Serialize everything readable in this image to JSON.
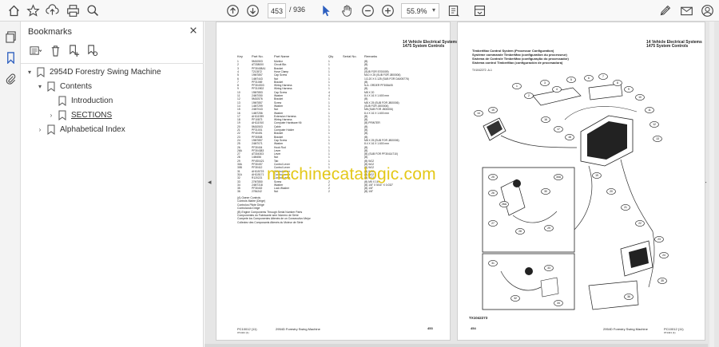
{
  "toolbar": {
    "page_current": "453",
    "page_separator": "/",
    "page_total": "936",
    "zoom": "55.9%",
    "icons": [
      "home-icon",
      "star-icon",
      "upload-icon",
      "print-icon",
      "search-icon",
      "page-up-icon",
      "page-down-icon",
      "cursor-icon",
      "hand-icon",
      "zoom-out-icon",
      "zoom-in-icon",
      "fit-page-icon",
      "view-mode-icon",
      "edit-pdf-icon",
      "mail-icon",
      "account-icon"
    ]
  },
  "sidebar": {
    "title": "Bookmarks",
    "items": [
      {
        "label": "2954D Forestry Swing Machine",
        "toggle": "▾",
        "level": 0
      },
      {
        "label": "Contents",
        "toggle": "▾",
        "level": 1
      },
      {
        "label": "Introduction",
        "toggle": "",
        "level": 2
      },
      {
        "label": "SECTIONS",
        "toggle": "›",
        "level": 2
      },
      {
        "label": "Alphabetical Index",
        "toggle": "›",
        "level": 1
      }
    ]
  },
  "document": {
    "watermark": "machinecatalogic.com",
    "left_page": {
      "header1": "14 Vehicle Electrical Systems",
      "header2": "1475 System Controls",
      "columns": [
        "Key",
        "Part No.",
        "Part Name",
        "Qty",
        "Serial No.",
        "Remarks"
      ],
      "rows": [
        [
          "1",
          "5M10503",
          "Monitor",
          "1",
          "",
          "(B)"
        ],
        [
          "2",
          "AT338000",
          "Circuit Bkr.",
          "1",
          "",
          "(B)"
        ],
        [
          "3",
          "PF30408A1",
          "Bracket",
          "1",
          "",
          "(B)"
        ],
        [
          "4",
          "T213572",
          "Hose Clamp",
          "1",
          "",
          "(SUB FOR 5700009)"
        ],
        [
          "5",
          "19M7857",
          "Cap Screw",
          "1",
          "",
          "M10 X 25 (SUB FOR J800006)"
        ],
        [
          "6",
          "14M7443",
          "Nut",
          "1",
          "",
          "1/2-20 X 0.125 (SUB FOR DA005776)"
        ],
        [
          "7",
          "PF31069",
          "Bracket",
          "1",
          "",
          "(B)"
        ],
        [
          "8",
          "PF304S03",
          "Wiring Harness",
          "1",
          "",
          "N.A. ORDER PF308A05"
        ],
        [
          "9",
          "PF310902",
          "Wiring Harness",
          "1",
          "",
          "(B)"
        ],
        [
          "10",
          "19M7853",
          "Cap Screw",
          "4",
          "",
          "M8 X 20"
        ],
        [
          "11",
          "24M7050",
          "Washer",
          "4",
          "",
          "8.4 X 16 X 1.600 mm"
        ],
        [
          "12",
          "5M10576",
          "Bracket",
          "1",
          "",
          "(B)"
        ],
        [
          "13",
          "19M7857",
          "Screw",
          "1",
          "",
          "M8 X 25 (SUB FOR J800006)"
        ],
        [
          "14",
          "14M7299",
          "Washer",
          "1",
          "",
          "(SUB FOR J800006)"
        ],
        [
          "15",
          "24M7043",
          "Nut",
          "1",
          "",
          "M8 (SUB FOR J800006)"
        ],
        [
          "16",
          "14M7256",
          "Washer",
          "1",
          "",
          "8.4 X 16 X 1.600 mm"
        ],
        [
          "17",
          "AH111939",
          "Extension Harness",
          "1",
          "",
          "(B)"
        ],
        [
          "18",
          "PF10873",
          "Wiring Harness",
          "1",
          "",
          "(B)"
        ],
        [
          "19",
          "AH111910",
          "Computer Hardware Kit",
          "1",
          "",
          "(B) PRINTER"
        ],
        [
          "20",
          "5M10503",
          "Cable",
          "1",
          "",
          "(B)"
        ],
        [
          "21",
          "PF31001",
          "Computer Holder",
          "1",
          "",
          "(B)"
        ],
        [
          "22",
          "PF40491",
          "Bracket",
          "1",
          "",
          "(B)"
        ],
        [
          "23",
          "PF30508",
          "Bracket",
          "1",
          "",
          "(B)"
        ],
        [
          "24",
          "19M7857",
          "Cap Screw",
          "1",
          "",
          "M8 X 25 (SUB FOR J800006)"
        ],
        [
          "25",
          "24M7071",
          "Washer",
          "1",
          "",
          "8.4 X 16 X 1.600 mm"
        ],
        [
          "26",
          "PF30404",
          "Hook Rod",
          "1",
          "",
          "(B)"
        ],
        [
          "26A",
          "PF304383",
          "Lever",
          "1",
          "",
          "(B)"
        ],
        [
          "27",
          "AT304303",
          "Lever",
          "1",
          "",
          "(B) (SUB FOR PF30414710)"
        ],
        [
          "28",
          "14M456",
          "Nut",
          "1",
          "",
          "(B)"
        ],
        [
          "29",
          "PF4S0421",
          "Tab",
          "1",
          "",
          "(B) W12"
        ],
        [
          "30A",
          "PF304S7",
          "Control Lever",
          "1",
          "",
          "(B) W12"
        ],
        [
          "30B",
          "PF30412",
          "Control Lever",
          "1",
          "",
          "(B) W12"
        ],
        [
          "31",
          "AH115723",
          "Control Lever",
          "1",
          "",
          "(B) W12"
        ],
        [
          "31A",
          "AH115171",
          "Control Lever",
          "1",
          "",
          "(B) W12"
        ],
        [
          "32",
          "R120221",
          "Control Lever",
          "1",
          "",
          "(B) W12"
        ],
        [
          "33",
          "27M7850",
          "Screw",
          "2",
          "",
          "(B) M5 X 16"
        ],
        [
          "34",
          "24M7318",
          "Washer",
          "2",
          "",
          "(B) 1/8\" X 5/16\" X 0.032\""
        ],
        [
          "35",
          "PF30402",
          "Lock Washer",
          "2",
          "",
          "(B) 1/8\""
        ],
        [
          "36",
          "2784242",
          "Nut",
          "2",
          "",
          "(B) 1/8\""
        ]
      ],
      "notes": [
        "(A) Owner Controls",
        "     Controls Maitre (Dirigé)",
        "     Controlos Pilote Dirigé",
        "     Controlando Dirigé",
        "(B) Engine Components Through Serial Number Parts",
        "     Componentes do Fabricante sem Número de Série",
        "     Compete los Componentes Attenés de un Consecutivo Mejor",
        "     Collectez des Composants Attenés du Moteur de Série"
      ],
      "footer_left": "PC10012 (11)",
      "footer_mid": "2954D Forestry Swing Machine",
      "footer_right": "453",
      "footer_sub": "071421 (1)"
    },
    "right_page": {
      "header1": "14 Vehicle Electrical Systems",
      "header2": "1475 System Controls",
      "title_lines": [
        "TimberMax Control System (Processor Configuration)",
        "Système commande TimberMax (configuration du processeur)",
        "Sistema de Controle TimberMax (configuração do processador)",
        "Sistema control TimberMax (configuración de procesadora)"
      ],
      "diagram_label": "TX1042272 -A-1",
      "figure_id": "TX1042273",
      "callouts": [
        "1",
        "2",
        "3",
        "4",
        "5",
        "6",
        "7",
        "8",
        "9",
        "10",
        "11",
        "12",
        "13",
        "14",
        "15",
        "16",
        "17",
        "18",
        "19",
        "20",
        "21",
        "22",
        "23",
        "24",
        "25",
        "26",
        "26A",
        "27",
        "28",
        "29",
        "30",
        "30A",
        "31",
        "32",
        "33",
        "34",
        "35",
        "36"
      ],
      "footer_left": "454",
      "footer_mid": "2954D Forestry Swing Machine",
      "footer_right": "PC10012 (11)",
      "footer_sub": "071421 (1)"
    }
  }
}
